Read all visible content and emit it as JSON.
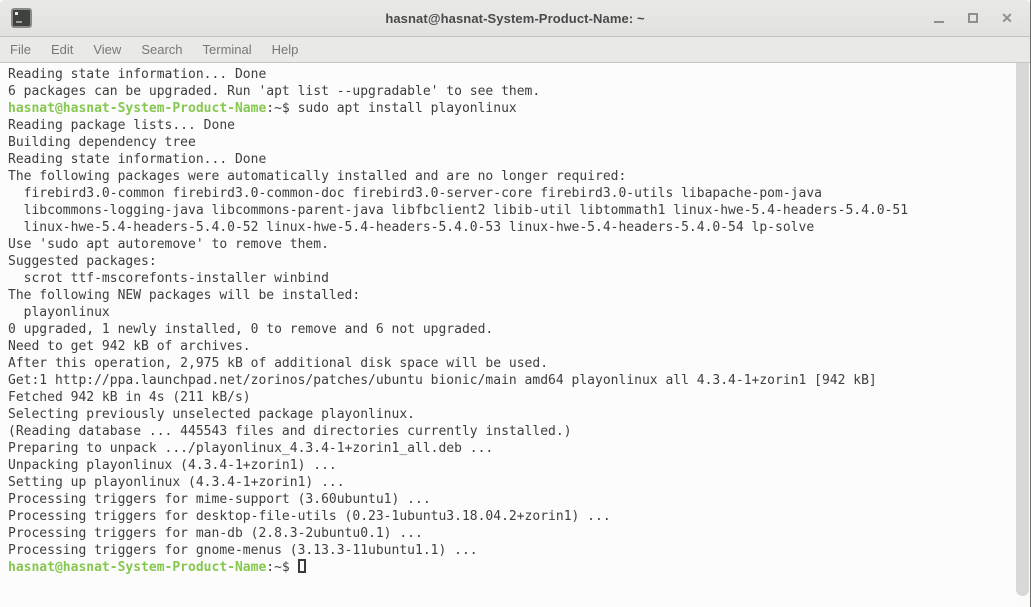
{
  "window": {
    "title": "hasnat@hasnat-System-Product-Name: ~",
    "controls": {
      "minimize_icon": "minimize-icon",
      "maximize_icon": "maximize-icon",
      "close_icon": "close-icon",
      "close_glyph": "✕"
    }
  },
  "menu": {
    "items": [
      {
        "label": "File"
      },
      {
        "label": "Edit"
      },
      {
        "label": "View"
      },
      {
        "label": "Search"
      },
      {
        "label": "Terminal"
      },
      {
        "label": "Help"
      }
    ]
  },
  "colors": {
    "prompt_green": "#86c74f",
    "terminal_bg": "#fcfcfc",
    "terminal_text": "#3e3e3e",
    "chrome_bg": "#e6e6e4"
  },
  "terminal": {
    "pre_command_lines": [
      "Reading state information... Done",
      "6 packages can be upgraded. Run 'apt list --upgradable' to see them."
    ],
    "prompt1": {
      "user": "hasnat@hasnat-System-Product-Name",
      "suffix": ":~$ ",
      "command": "sudo apt install playonlinux"
    },
    "output": [
      "Reading package lists... Done",
      "Building dependency tree",
      "Reading state information... Done",
      "The following packages were automatically installed and are no longer required:",
      "  firebird3.0-common firebird3.0-common-doc firebird3.0-server-core firebird3.0-utils libapache-pom-java",
      "  libcommons-logging-java libcommons-parent-java libfbclient2 libib-util libtommath1 linux-hwe-5.4-headers-5.4.0-51",
      "  linux-hwe-5.4-headers-5.4.0-52 linux-hwe-5.4-headers-5.4.0-53 linux-hwe-5.4-headers-5.4.0-54 lp-solve",
      "Use 'sudo apt autoremove' to remove them.",
      "Suggested packages:",
      "  scrot ttf-mscorefonts-installer winbind",
      "The following NEW packages will be installed:",
      "  playonlinux",
      "0 upgraded, 1 newly installed, 0 to remove and 6 not upgraded.",
      "Need to get 942 kB of archives.",
      "After this operation, 2,975 kB of additional disk space will be used.",
      "Get:1 http://ppa.launchpad.net/zorinos/patches/ubuntu bionic/main amd64 playonlinux all 4.3.4-1+zorin1 [942 kB]",
      "Fetched 942 kB in 4s (211 kB/s)",
      "Selecting previously unselected package playonlinux.",
      "(Reading database ... 445543 files and directories currently installed.)",
      "Preparing to unpack .../playonlinux_4.3.4-1+zorin1_all.deb ...",
      "Unpacking playonlinux (4.3.4-1+zorin1) ...",
      "Setting up playonlinux (4.3.4-1+zorin1) ...",
      "Processing triggers for mime-support (3.60ubuntu1) ...",
      "Processing triggers for desktop-file-utils (0.23-1ubuntu3.18.04.2+zorin1) ...",
      "Processing triggers for man-db (2.8.3-2ubuntu0.1) ...",
      "Processing triggers for gnome-menus (3.13.3-11ubuntu1.1) ..."
    ],
    "prompt2": {
      "user": "hasnat@hasnat-System-Product-Name",
      "suffix": ":~$ "
    }
  }
}
